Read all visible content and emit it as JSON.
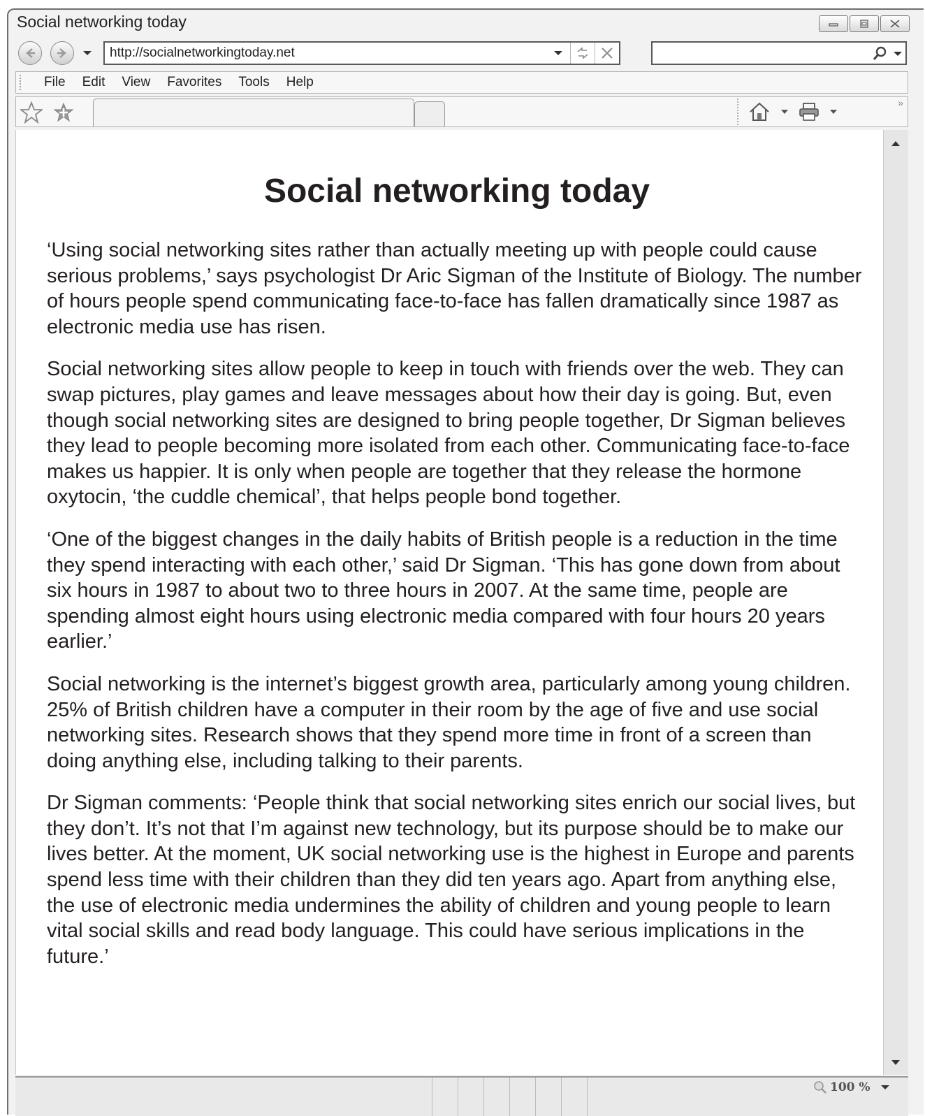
{
  "window": {
    "title": "Social networking today"
  },
  "navigation": {
    "url": "http://socialnetworkingtoday.net",
    "search_placeholder": ""
  },
  "menu": {
    "items": [
      "File",
      "Edit",
      "View",
      "Favorites",
      "Tools",
      "Help"
    ]
  },
  "page": {
    "title": "Social networking today",
    "paragraphs": [
      "‘Using social networking sites rather than actually meeting up with people could cause serious problems,’ says psychologist Dr Aric Sigman of the Institute of Biology. The number of hours people spend communicating face-to-face has fallen dramatically since 1987 as electronic media use has risen.",
      "Social networking sites allow people to keep in touch with friends over the web. They can swap pictures, play games and leave messages about how their day is going. But, even though social networking sites are designed to bring people together, Dr Sigman believes they lead to people becoming more isolated from each other. Communicating face-to-face makes us happier. It is only when people are together that they release the hormone oxytocin, ‘the cuddle chemical’, that helps people bond together.",
      "‘One of the biggest changes in the daily habits of British people is a reduction in the time they spend interacting with each other,’ said Dr Sigman. ‘This has gone down from about six hours in 1987 to about two to three hours in 2007. At the same time, people are spending almost eight hours using electronic media compared with four hours 20 years earlier.’",
      "Social networking is the internet’s biggest growth area, particularly among young children. 25% of British children have a computer in their room by the age of five and use social networking sites. Research shows that they spend more time in front of a screen than doing anything else, including talking to their parents.",
      "Dr Sigman comments: ‘People think that social networking sites enrich our social lives, but they don’t. It’s not that I’m against new technology, but its purpose should be to make our lives better. At the moment, UK social networking use is the highest in Europe and parents spend less time with their children than they did ten years ago. Apart from anything else, the use of electronic media undermines the ability of children and young people to learn vital social skills and read body language. This could have serious implications in the future.’"
    ]
  },
  "statusbar": {
    "zoom": "100 %"
  },
  "icons": {
    "back": "back-arrow-icon",
    "forward": "forward-arrow-icon",
    "refresh": "refresh-icon",
    "stop": "stop-icon",
    "search": "magnifier-icon",
    "favorites": "star-icon",
    "add_favorite": "add-star-icon",
    "home": "home-icon",
    "print": "printer-icon",
    "zoom": "zoom-magnifier-icon"
  }
}
